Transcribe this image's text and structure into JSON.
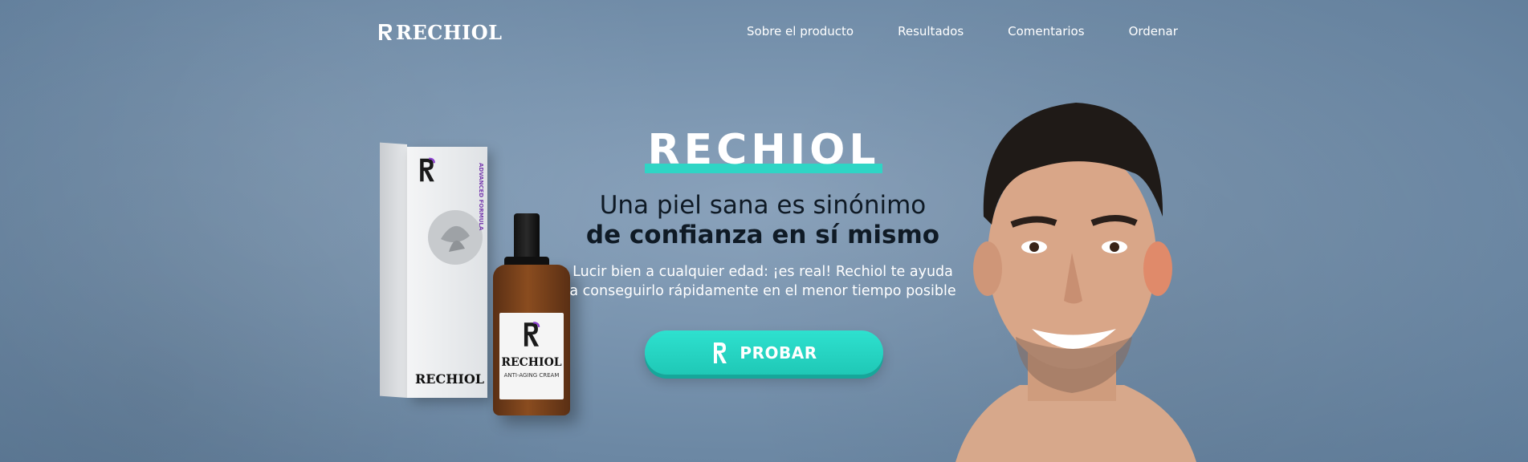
{
  "brand": {
    "logo_text": "RECHIOL"
  },
  "nav": {
    "items": [
      {
        "label": "Sobre el producto"
      },
      {
        "label": "Resultados"
      },
      {
        "label": "Comentarios"
      },
      {
        "label": "Ordenar"
      }
    ]
  },
  "hero": {
    "title": "RECHIOL",
    "tagline_line1": "Una piel sana es sinónimo",
    "tagline_line2": "de confianza en sí mismo",
    "subtext_line1": "Lucir bien a cualquier edad: ¡es real! Rechiol te ayuda",
    "subtext_line2": "a conseguirlo rápidamente en el menor tiempo posible",
    "cta_label": "PROBAR"
  },
  "product": {
    "box_brand": "RECHIOL",
    "box_side_text": "ADVANCED FORMULA",
    "bottle_brand": "RECHIOL",
    "bottle_subtitle": "ANTI-AGING CREAM"
  },
  "colors": {
    "accent": "#2fd5c5",
    "background": "#7893ae",
    "cta": "#2ee1cf",
    "text_dark": "#0f1a25",
    "text_light": "#ffffff"
  }
}
